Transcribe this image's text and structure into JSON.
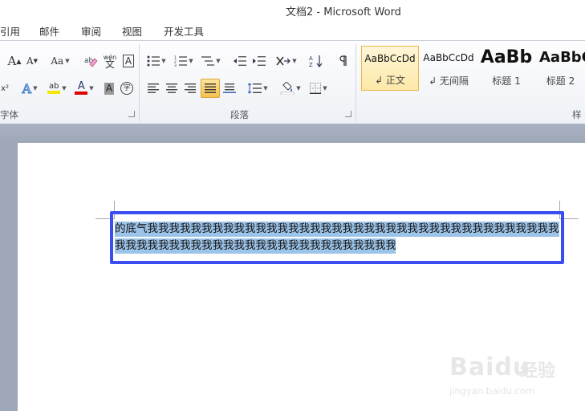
{
  "window": {
    "title": "文档2  -  Microsoft Word"
  },
  "tabs": [
    "引用",
    "邮件",
    "审阅",
    "视图",
    "开发工具"
  ],
  "ribbon": {
    "groups": {
      "font_label": "字体",
      "paragraph_label": "段落",
      "styles_label": "样"
    },
    "styles": [
      {
        "preview": "AaBbCcDd",
        "name": "↲ 正文",
        "selected": true
      },
      {
        "preview": "AaBbCcDd",
        "name": "↲ 无间隔",
        "selected": false
      },
      {
        "preview": "AaBb",
        "name": "标题 1",
        "selected": false
      },
      {
        "preview": "AaBbC",
        "name": "标题 2",
        "selected": false
      }
    ],
    "font_buttons": {
      "grow_font": "A",
      "shrink_font": "A",
      "change_case": "Aa",
      "phonetic": "wén",
      "char_border": "A",
      "font_color": "A",
      "char_shading": "A",
      "enclose": "字"
    }
  },
  "document": {
    "line1": "的底气我我我我我我我我我我我我我我我我我我我我我我我我我我我我我我我我我我我我我我",
    "line2": "我我我我我我我我我我我我我我我我我我我我我我我我我我我我我我我我我我",
    "paragraph_mark": "↲"
  },
  "watermark": {
    "brand": "Baidu",
    "cn": "经验",
    "url": "jingyan.baidu.com"
  },
  "colors": {
    "selection_highlight": "#9cc3e8",
    "annotation_box": "#3a4df0",
    "font_color_bar": "#e00000",
    "highlight_bar": "#f5e600"
  }
}
